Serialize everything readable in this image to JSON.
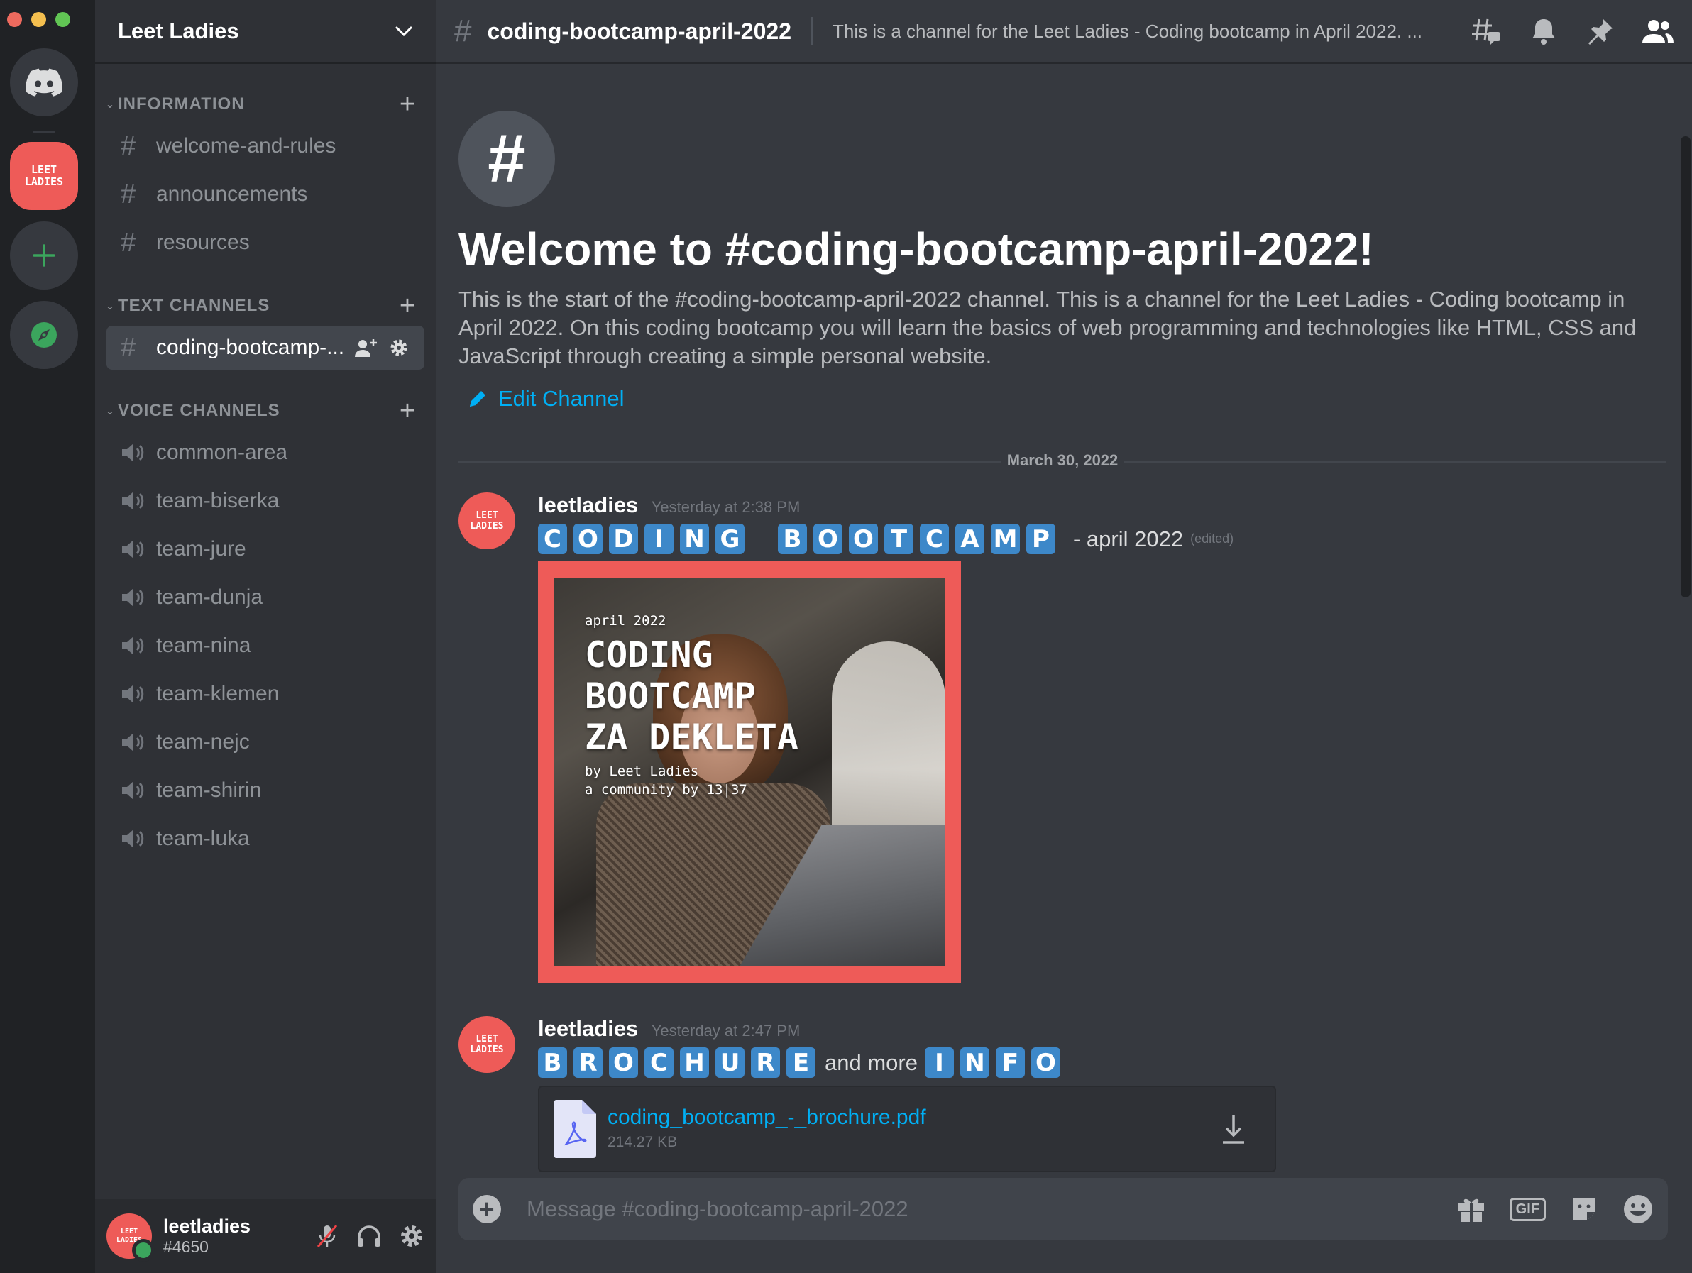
{
  "window": {
    "traffic_colors": [
      "#ed6a5e",
      "#f4bf4f",
      "#61c554"
    ]
  },
  "rail": {
    "servers": [
      {
        "name": "discord-home",
        "icon": "discord-logo-icon"
      },
      {
        "name": "leet-ladies",
        "label_line1": "LEET",
        "label_line2": "LADIES",
        "color": "#ee5b58"
      },
      {
        "name": "add-server",
        "icon": "plus-icon",
        "color": "#3ba55d"
      },
      {
        "name": "explore",
        "icon": "compass-icon",
        "color": "#3ba55d"
      }
    ]
  },
  "sidebar": {
    "guild_name": "Leet Ladies",
    "categories": [
      {
        "label": "INFORMATION",
        "channels": [
          "welcome-and-rules",
          "announcements",
          "resources"
        ]
      },
      {
        "label": "TEXT CHANNELS",
        "channels": [
          "coding-bootcamp-..."
        ]
      },
      {
        "label": "VOICE CHANNELS",
        "channels": [
          "common-area",
          "team-biserka",
          "team-jure",
          "team-dunja",
          "team-nina",
          "team-klemen",
          "team-nejc",
          "team-shirin",
          "team-luka"
        ]
      }
    ]
  },
  "user": {
    "name": "leetladies",
    "tag": "#4650",
    "avatar_line1": "LEET",
    "avatar_line2": "LADIES"
  },
  "channel": {
    "name": "coding-bootcamp-april-2022",
    "topic": "This is a channel for the Leet Ladies - Coding bootcamp in April 2022. ...",
    "welcome_icon": "#",
    "welcome_title": "Welcome to #coding-bootcamp-april-2022!",
    "welcome_desc": "This is the start of the #coding-bootcamp-april-2022 channel. This is a channel for the Leet Ladies - Coding bootcamp in April 2022. On this coding bootcamp you will learn the basics of web programming and technologies like HTML, CSS and JavaScript through creating a simple personal website.",
    "edit_label": "Edit Channel",
    "date_divider": "March 30, 2022"
  },
  "messages": [
    {
      "author": "leetladies",
      "time": "Yesterday at 2:38 PM",
      "word1": "CODING",
      "word2": "BOOTCAMP",
      "text": "- april 2022",
      "edited": "(edited)",
      "poster": {
        "small_top": "april 2022",
        "line1": "CODING",
        "line2": "BOOTCAMP",
        "line3": "ZA DEKLETA",
        "by": "by Leet Ladies",
        "community": "a community by 13|37",
        "frame_color": "#ee5b58"
      }
    },
    {
      "author": "leetladies",
      "time": "Yesterday at 2:47 PM",
      "word1": "BROCHURE",
      "text": "and more",
      "word2": "INFO",
      "attachment": {
        "name": "coding_bootcamp_-_brochure.pdf",
        "size": "214.27 KB"
      }
    }
  ],
  "composer": {
    "placeholder": "Message #coding-bootcamp-april-2022",
    "gif_label": "GIF"
  },
  "colors": {
    "accent_link": "#00aff4",
    "brand_red": "#ee5b58",
    "regional_blue": "#3d88c9",
    "online_green": "#3ba55d"
  }
}
